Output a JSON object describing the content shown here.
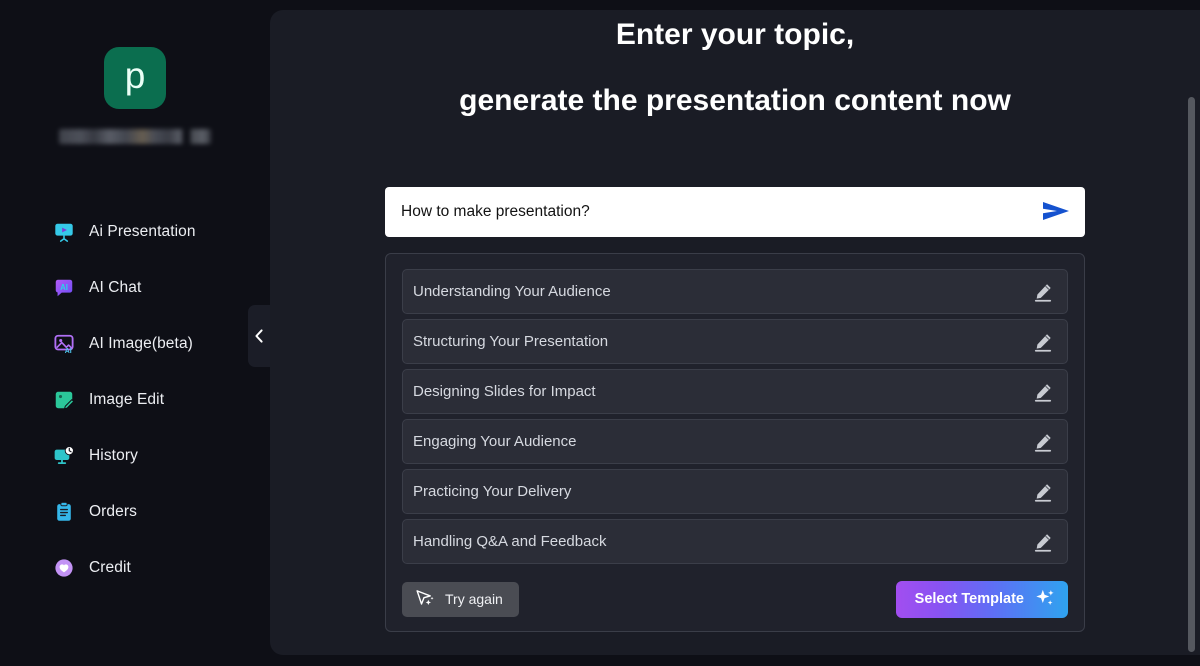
{
  "brand": {
    "logo_letter": "p",
    "name_redacted": true,
    "logo_color": "#0b6e4f"
  },
  "sidebar": {
    "items": [
      {
        "label": "Ai Presentation",
        "icon": "presentation-screen-icon",
        "icon_color": "#35c9e8"
      },
      {
        "label": "AI Chat",
        "icon": "ai-chat-icon",
        "icon_color": "#a855f7"
      },
      {
        "label": "AI Image(beta)",
        "icon": "ai-image-icon",
        "icon_color": "#b06ff5"
      },
      {
        "label": "Image Edit",
        "icon": "image-edit-icon",
        "icon_color": "#2bc79a"
      },
      {
        "label": "History",
        "icon": "history-monitor-icon",
        "icon_color": "#2ec4c9"
      },
      {
        "label": "Orders",
        "icon": "orders-clipboard-icon",
        "icon_color": "#35b7ea"
      },
      {
        "label": "Credit",
        "icon": "credit-heart-icon",
        "icon_color": "#c393f5"
      }
    ],
    "collapse_icon": "chevron-left-icon"
  },
  "main": {
    "headline_line1": "Enter your topic,",
    "headline_line2": "generate the presentation content now",
    "search": {
      "value": "How to make presentation?",
      "placeholder": "How to make presentation?",
      "send_icon": "send-arrow-icon",
      "send_color": "#1552cf"
    },
    "outline": {
      "items": [
        {
          "title": "Understanding Your Audience",
          "edit_icon": "pencil-edit-icon"
        },
        {
          "title": "Structuring Your Presentation",
          "edit_icon": "pencil-edit-icon"
        },
        {
          "title": "Designing Slides for Impact",
          "edit_icon": "pencil-edit-icon"
        },
        {
          "title": "Engaging Your Audience",
          "edit_icon": "pencil-edit-icon"
        },
        {
          "title": "Practicing Your Delivery",
          "edit_icon": "pencil-edit-icon"
        },
        {
          "title": "Handling Q&A and Feedback",
          "edit_icon": "pencil-edit-icon"
        }
      ],
      "try_again_label": "Try again",
      "try_again_icon": "magic-cursor-icon",
      "select_template_label": "Select Template",
      "select_template_icon": "sparkles-icon",
      "select_template_gradient_from": "#a24ef0",
      "select_template_gradient_to": "#2fa3ef"
    }
  },
  "scrollbar": {
    "name": "vertical-scrollbar",
    "color": "#55585f"
  }
}
